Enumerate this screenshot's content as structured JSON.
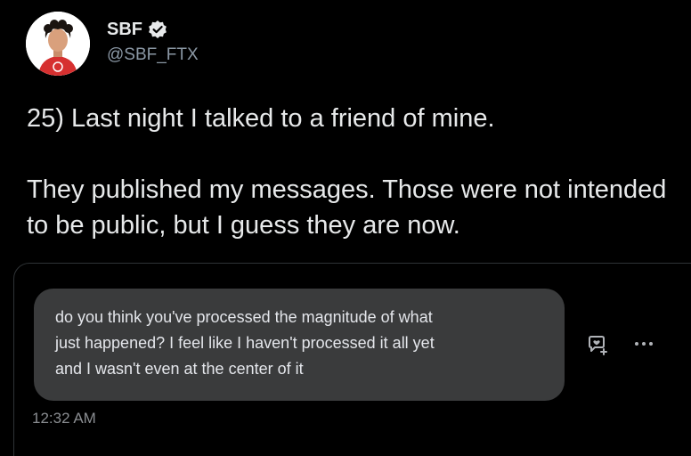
{
  "author": {
    "display_name": "SBF",
    "handle": "@SBF_FTX",
    "verified": true
  },
  "tweet": {
    "paragraphs": [
      "25) Last night I talked to a friend of mine.",
      "They published my messages.  Those were not intended to be public, but I guess they are now."
    ]
  },
  "media": {
    "message_lines": [
      "do you think you've processed the magnitude of what",
      "just happened? I feel like I haven't processed it all yet",
      "and I wasn't even at the center of it"
    ],
    "timestamp": "12:32 AM",
    "icons": [
      "add-reaction-icon",
      "more-options-icon"
    ]
  },
  "colors": {
    "background": "#000000",
    "text": "#e7e9ea",
    "secondary_text": "#8b98a5",
    "bubble": "#3a3b3c",
    "bubble_text": "#e4e6eb",
    "card_border": "#2f3336"
  }
}
